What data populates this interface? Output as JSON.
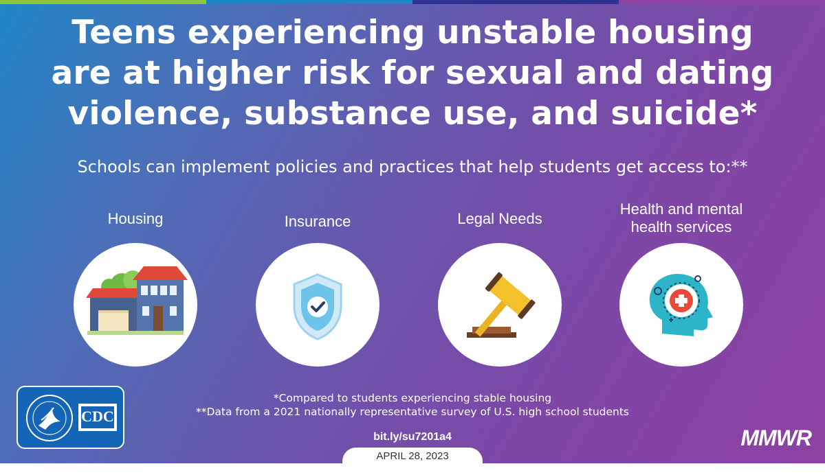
{
  "colors": {
    "background_start": "#1f86c6",
    "background_end": "#8c42a3",
    "top_bar": [
      "#8dc63f",
      "#1f86c6",
      "#2e3192",
      "#8c42a3"
    ],
    "logo_box": "#1565b7"
  },
  "headline": {
    "lines": [
      "Teens experiencing unstable housing",
      "are at higher risk for sexual and dating",
      "violence, substance use, and suicide*"
    ]
  },
  "subtitle": "Schools can implement policies and practices that help students get access to:**",
  "items": [
    {
      "label": "Housing",
      "icon": "house-icon"
    },
    {
      "label": "Insurance",
      "icon": "shield-check-icon"
    },
    {
      "label": "Legal Needs",
      "icon": "gavel-icon"
    },
    {
      "label_lines": [
        "Health and mental",
        "health services"
      ],
      "icon": "mental-health-icon"
    }
  ],
  "footnotes": [
    "*Compared to students experiencing stable housing",
    "**Data from a 2021 nationally representative survey of U.S. high school students"
  ],
  "link": "bit.ly/su7201a4",
  "date": "APRIL 28, 2023",
  "logo": {
    "cdc_text": "CDC",
    "icon": "hhs-eagle-icon"
  },
  "brand": "MMWR"
}
